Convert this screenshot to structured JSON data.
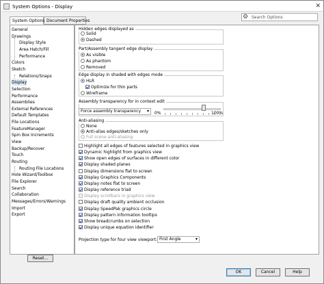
{
  "window": {
    "title": "System Options - Display",
    "close": "✕"
  },
  "tabs": [
    {
      "label": "System Options"
    },
    {
      "label": "Document Properties"
    }
  ],
  "search": {
    "placeholder": "Search Options"
  },
  "nav": {
    "items": [
      "General",
      "Drawings",
      "Display Style",
      "Area Hatch/Fill",
      "Performance",
      "Colors",
      "Sketch",
      "Relations/Snaps",
      "Display",
      "Selection",
      "Performance",
      "Assemblies",
      "External References",
      "Default Templates",
      "File Locations",
      "FeatureManager",
      "Spin Box Increments",
      "View",
      "Backup/Recover",
      "Touch",
      "Routing",
      "Routing File Locations",
      "Hole Wizard/Toolbox",
      "File Explorer",
      "Search",
      "Collaboration",
      "Messages/Errors/Warnings",
      "Import",
      "Export"
    ],
    "selected": "Display"
  },
  "reset_label": "Reset...",
  "hidden_edges": {
    "title": "Hidden edges displayed as",
    "options": [
      "Solid",
      "Dashed"
    ],
    "selected": "Dashed"
  },
  "tangent_edges": {
    "title": "Part/Assembly tangent edge display",
    "options": [
      "As visible",
      "As phantom",
      "Removed"
    ],
    "selected": "As visible"
  },
  "shaded_edges": {
    "title": "Edge display in shaded with edges mode",
    "options": [
      "HLR",
      "Wireframe"
    ],
    "selected": "HLR",
    "sub_checkbox": {
      "label": "Optimize for thin parts",
      "checked": true
    }
  },
  "transparency": {
    "title": "Assembly transparency for in context edit",
    "select_value": "Force assembly transparency",
    "min_label": "0%",
    "max_label": "100%",
    "value_fraction": 0.7
  },
  "anti_aliasing": {
    "title": "Anti-aliasing",
    "options": [
      "None",
      "Anti-alias edges/sketches only",
      "Full scene anti-aliasing"
    ],
    "selected": "Anti-alias edges/sketches only",
    "disabled": [
      "Full scene anti-aliasing"
    ]
  },
  "checkboxes": [
    {
      "label": "Highlight all edges of features selected in graphics view",
      "checked": false
    },
    {
      "label": "Dynamic highlight from graphics view",
      "checked": true
    },
    {
      "label": "Show open edges of surfaces in different color",
      "checked": true
    },
    {
      "label": "Display shaded planes",
      "checked": true
    },
    {
      "label": "Display dimensions flat to screen",
      "checked": false
    },
    {
      "label": "Display Graphics Components",
      "checked": true
    },
    {
      "label": "Display notes flat to screen",
      "checked": true
    },
    {
      "label": "Display reference triad",
      "checked": true
    },
    {
      "label": "Display scrollbars in graphics view",
      "checked": false,
      "disabled": true
    },
    {
      "label": "Display draft quality ambient occlusion",
      "checked": false
    },
    {
      "label": "Display SpeedPak graphics circle",
      "checked": true
    },
    {
      "label": "Display pattern information tooltips",
      "checked": true
    },
    {
      "label": "Show breadcrumbs on selection",
      "checked": true
    },
    {
      "label": "Display unique equation identifier",
      "checked": true
    }
  ],
  "projection": {
    "label": "Projection type for four view viewport:",
    "value": "First Angle"
  },
  "buttons": {
    "ok": "OK",
    "cancel": "Cancel",
    "help": "Help"
  },
  "icons": {
    "search": "search-icon",
    "settings": "gear-icon",
    "window": "app-icon",
    "close": "close-icon",
    "dropdown": "chevron-down-icon"
  }
}
